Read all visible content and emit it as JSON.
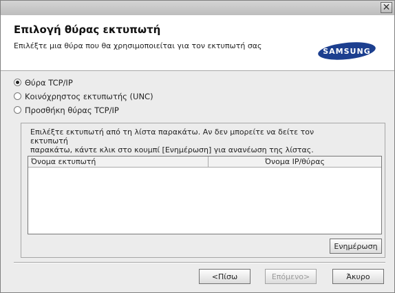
{
  "window": {
    "close_glyph": "✕"
  },
  "header": {
    "title": "Επιλογή θύρας εκτυπωτή",
    "subtitle": "Επιλέξτε μια θύρα που θα χρησιμοποιείται για τον εκτυπωτή σας",
    "logo": "SAMSUNG"
  },
  "port_options": [
    {
      "label": "Θύρα TCP/IP",
      "checked": true
    },
    {
      "label": "Κοινόχρηστος εκτυπωτής (UNC)",
      "checked": false
    },
    {
      "label": "Προσθήκη θύρας TCP/IP",
      "checked": false
    }
  ],
  "printer_group": {
    "instruction_line1": "Επιλέξτε εκτυπωτή από τη λίστα παρακάτω. Αν δεν μπορείτε να δείτε τον εκτυπωτή",
    "instruction_line2": "παρακάτω, κάντε κλικ στο κουμπί [Ενημέρωση] για ανανέωση της λίστας.",
    "columns": [
      "Όνομα εκτυπωτή",
      "Όνομα IP/θύρας"
    ],
    "rows": [],
    "refresh_label": "Ενημέρωση"
  },
  "footer": {
    "back_label": "<Πίσω",
    "next_label": "Επόμενο>",
    "cancel_label": "Άκυρο"
  },
  "colors": {
    "logo_blue": "#1c3f8f",
    "dialog_bg": "#ececec"
  }
}
